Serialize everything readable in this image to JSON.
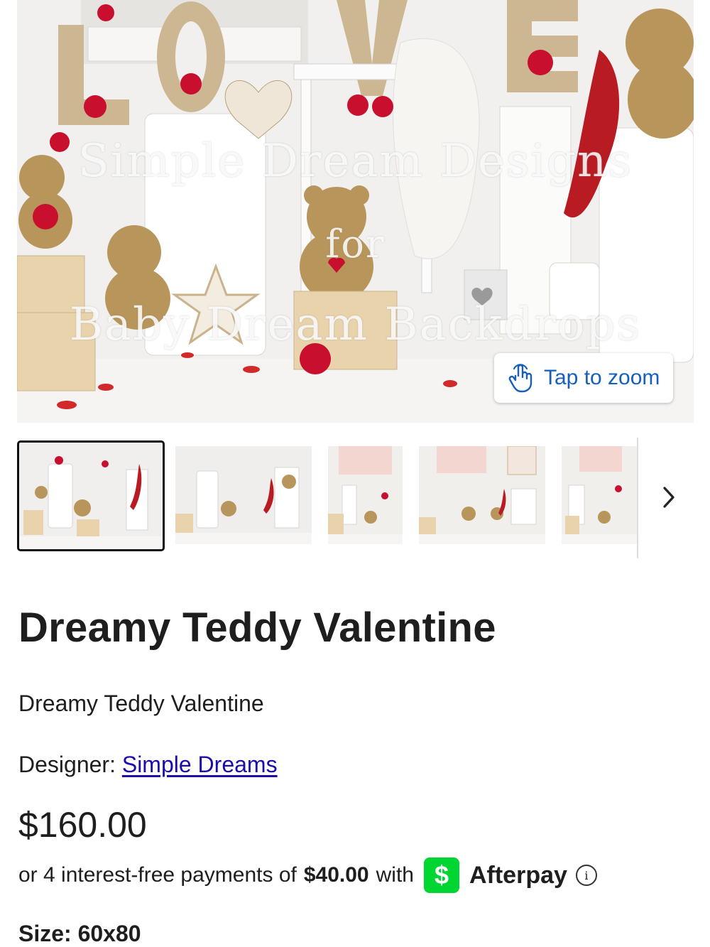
{
  "hero": {
    "watermark_line1": "Simple Dream Designs",
    "watermark_line2": "for",
    "watermark_line3": "Baby Dream Backdrops",
    "zoom_label": "Tap to zoom"
  },
  "gallery": {
    "thumbnail_count": 5,
    "active_index": 0,
    "next_icon": "chevron-right-icon"
  },
  "product": {
    "title": "Dreamy Teddy Valentine",
    "description": "Dreamy Teddy Valentine",
    "designer_label": "Designer: ",
    "designer_name": "Simple Dreams",
    "price": "$160.00",
    "installment_prefix": "or 4 interest-free payments of",
    "installment_amount": "$40.00",
    "installment_suffix": "with",
    "cashapp_symbol": "$",
    "afterpay_brand": "Afterpay",
    "info_symbol": "i",
    "size_label": "Size: 60x80"
  },
  "colors": {
    "link": "#1a0dab",
    "zoom_text": "#1560bd",
    "cashapp_green": "#00d632",
    "accent_red": "#c8102e"
  }
}
